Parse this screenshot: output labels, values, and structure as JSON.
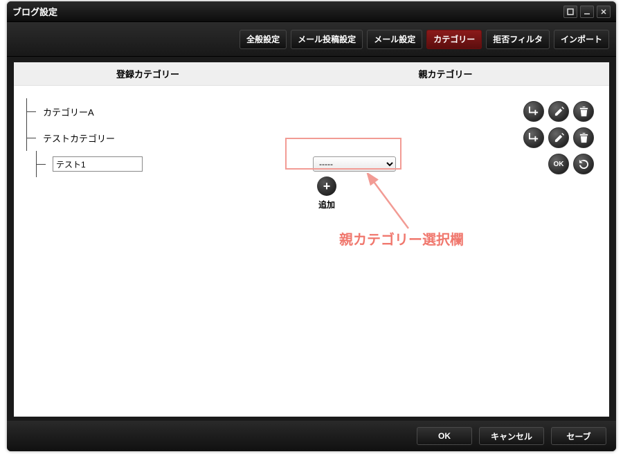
{
  "window": {
    "title": "ブログ設定"
  },
  "tabs": [
    {
      "label": "全般設定",
      "active": false
    },
    {
      "label": "メール投稿設定",
      "active": false
    },
    {
      "label": "メール設定",
      "active": false
    },
    {
      "label": "カテゴリー",
      "active": true
    },
    {
      "label": "拒否フィルタ",
      "active": false
    },
    {
      "label": "インポート",
      "active": false
    }
  ],
  "columns": {
    "registered": "登録カテゴリー",
    "parent": "親カテゴリー"
  },
  "categories": [
    {
      "label": "カテゴリーA",
      "editable": false,
      "depth": 0
    },
    {
      "label": "テストカテゴリー",
      "editable": false,
      "depth": 0
    },
    {
      "label": "テスト1",
      "editable": true,
      "depth": 1,
      "parent_select_value": "-----"
    }
  ],
  "add": {
    "label": "追加"
  },
  "row_buttons": {
    "add_child": "↳+",
    "edit": "edit",
    "delete": "delete",
    "ok": "OK",
    "revert": "revert"
  },
  "annotation": {
    "text": "親カテゴリー選択欄"
  },
  "footer": {
    "ok": "OK",
    "cancel": "キャンセル",
    "save": "セーブ"
  }
}
